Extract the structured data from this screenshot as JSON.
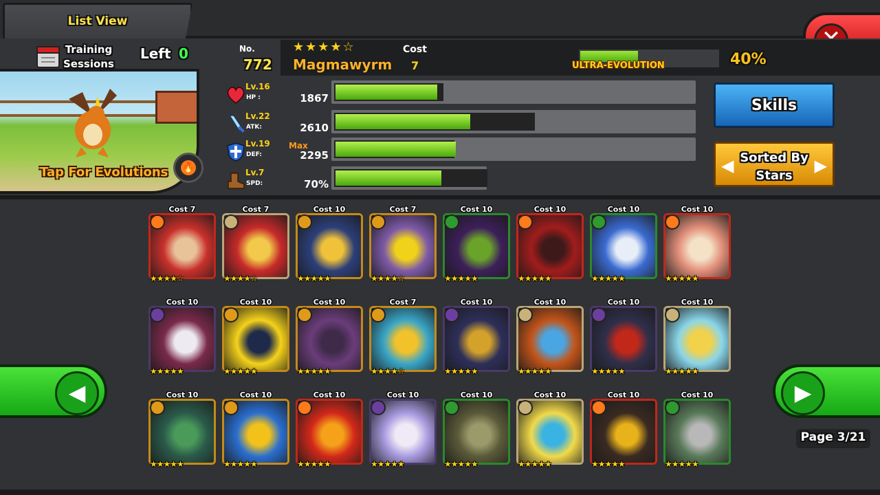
{
  "header": {
    "title": "List View"
  },
  "training": {
    "label_line1": "Training",
    "label_line2": "Sessions",
    "left_label": "Left",
    "left_value": "0"
  },
  "monster": {
    "number_label": "No.",
    "number": "772",
    "stars": "★★★★☆",
    "name": "Magmawyrm",
    "cost_label": "Cost",
    "cost": "7",
    "evolution_label": "ULTRA-EVOLUTION",
    "evolution_percent": "40%",
    "evolution_progress": 0.4,
    "tap_label": "Tap For Evolutions"
  },
  "stats": [
    {
      "level": "Lv.16",
      "key": "HP :",
      "value": "1867",
      "icon": "heart-icon",
      "track": 0.3,
      "fill": 0.28
    },
    {
      "level": "Lv.22",
      "key": "ATK:",
      "value": "2610",
      "icon": "sword-icon",
      "track": 0.55,
      "fill": 0.37
    },
    {
      "level": "Lv.19",
      "key": "DEF:",
      "value": "2295",
      "icon": "shield-icon",
      "track": 0.33,
      "fill": 0.33,
      "badge": "Max"
    },
    {
      "level": "Lv.7",
      "key": "SPD:",
      "value": "70%",
      "icon": "boot-icon",
      "track": 0.42,
      "fill": 0.29
    }
  ],
  "buttons": {
    "skills": "Skills",
    "sort_line1": "Sorted By",
    "sort_line2": "Stars"
  },
  "pagination": {
    "page": "Page 3/21"
  },
  "colors": {
    "fire": "#ff7a1a",
    "water": "#e09a1a",
    "nature": "#2f9b2f",
    "dark": "#6b3fa0",
    "light": "#c9b27a"
  },
  "grid": [
    {
      "cost": "Cost 7",
      "stars": "★★★★☆",
      "element": "fire",
      "art": [
        "#c9302b",
        "#e8c39a"
      ]
    },
    {
      "cost": "Cost 7",
      "stars": "★★★★☆",
      "element": "light",
      "art": [
        "#c72a2a",
        "#f2c94a"
      ]
    },
    {
      "cost": "Cost 10",
      "stars": "★★★★★",
      "element": "water",
      "art": [
        "#2c3f7a",
        "#f0c23a"
      ]
    },
    {
      "cost": "Cost 7",
      "stars": "★★★★☆",
      "element": "water",
      "art": [
        "#7e5aa8",
        "#f0d21a"
      ]
    },
    {
      "cost": "Cost 10",
      "stars": "★★★★★",
      "element": "nature",
      "art": [
        "#3d1f5a",
        "#6aa32a"
      ]
    },
    {
      "cost": "Cost 10",
      "stars": "★★★★★",
      "element": "fire",
      "art": [
        "#a21c1c",
        "#3c1a1a"
      ]
    },
    {
      "cost": "Cost 10",
      "stars": "★★★★★",
      "element": "nature",
      "art": [
        "#3a6bd1",
        "#e8eef8"
      ]
    },
    {
      "cost": "Cost 10",
      "stars": "★★★★★",
      "element": "fire",
      "art": [
        "#e28f7a",
        "#f4e1c6"
      ]
    },
    {
      "cost": "Cost 10",
      "stars": "★★★★★",
      "element": "dark",
      "art": [
        "#7a2a4a",
        "#eeeaf2"
      ]
    },
    {
      "cost": "Cost 10",
      "stars": "★★★★★",
      "element": "water",
      "art": [
        "#f5d21a",
        "#1e2a4a"
      ]
    },
    {
      "cost": "Cost 10",
      "stars": "★★★★★",
      "element": "water",
      "art": [
        "#6a3d7a",
        "#3f2a4a"
      ]
    },
    {
      "cost": "Cost 7",
      "stars": "★★★★☆",
      "element": "water",
      "art": [
        "#3aa6c8",
        "#f2c22a"
      ]
    },
    {
      "cost": "Cost 10",
      "stars": "★★★★★",
      "element": "dark",
      "art": [
        "#2e2f5a",
        "#d4a22a"
      ]
    },
    {
      "cost": "Cost 10",
      "stars": "★★★★★",
      "element": "light",
      "art": [
        "#c3541a",
        "#4aa6e2"
      ]
    },
    {
      "cost": "Cost 10",
      "stars": "★★★★★",
      "element": "dark",
      "art": [
        "#2f2f4a",
        "#c2281a"
      ]
    },
    {
      "cost": "Cost 10",
      "stars": "★★★★★",
      "element": "light",
      "art": [
        "#8ad6ea",
        "#f2d24a"
      ]
    },
    {
      "cost": "Cost 10",
      "stars": "★★★★★",
      "element": "water",
      "art": [
        "#2a5a4a",
        "#4a9a5a"
      ]
    },
    {
      "cost": "Cost 10",
      "stars": "★★★★★",
      "element": "water",
      "art": [
        "#2a6fd1",
        "#f2c21a"
      ]
    },
    {
      "cost": "Cost 10",
      "stars": "★★★★★",
      "element": "fire",
      "art": [
        "#d2281a",
        "#f5a21a"
      ]
    },
    {
      "cost": "Cost 10",
      "stars": "★★★★★",
      "element": "dark",
      "art": [
        "#a99be0",
        "#efeaf5"
      ]
    },
    {
      "cost": "Cost 10",
      "stars": "★★★★★",
      "element": "nature",
      "art": [
        "#5a5a3a",
        "#9a9a6a"
      ]
    },
    {
      "cost": "Cost 10",
      "stars": "★★★★★",
      "element": "light",
      "art": [
        "#f2da4a",
        "#3ab2e2"
      ]
    },
    {
      "cost": "Cost 10",
      "stars": "★★★★★",
      "element": "fire",
      "art": [
        "#3a2a22",
        "#e8b21a"
      ]
    },
    {
      "cost": "Cost 10",
      "stars": "★★★★★",
      "element": "nature",
      "art": [
        "#5a7a5a",
        "#b8b8b8"
      ]
    }
  ]
}
